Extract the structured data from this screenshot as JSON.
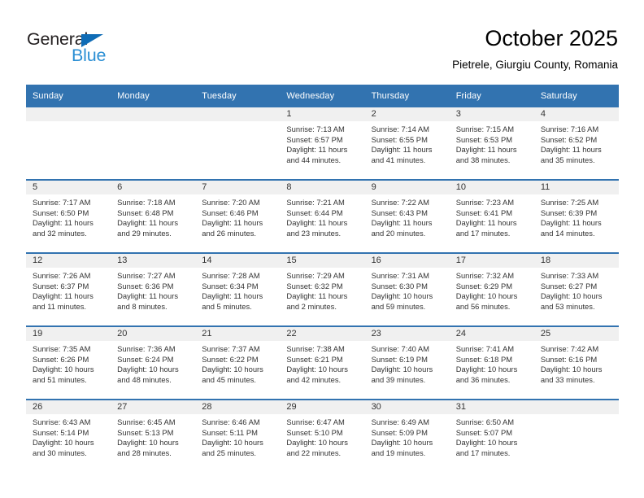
{
  "brand": {
    "name_part1": "General",
    "name_part2": "Blue",
    "primary_color": "#2b8fd4",
    "dark_color": "#231f20",
    "triangle_color": "#0f6cb6"
  },
  "header": {
    "title": "October 2025",
    "subtitle": "Pietrele, Giurgiu County, Romania"
  },
  "theme": {
    "header_row_bg": "#3273b0",
    "header_row_text": "#ffffff",
    "daynum_strip_bg": "#f0f0f0",
    "week_separator": "#3273b0",
    "body_text": "#333333"
  },
  "weekday_headers": [
    "Sunday",
    "Monday",
    "Tuesday",
    "Wednesday",
    "Thursday",
    "Friday",
    "Saturday"
  ],
  "weeks": [
    [
      {
        "day": "",
        "sunrise": "",
        "sunset": "",
        "daylight_line1": "",
        "daylight_line2": ""
      },
      {
        "day": "",
        "sunrise": "",
        "sunset": "",
        "daylight_line1": "",
        "daylight_line2": ""
      },
      {
        "day": "",
        "sunrise": "",
        "sunset": "",
        "daylight_line1": "",
        "daylight_line2": ""
      },
      {
        "day": "1",
        "sunrise": "Sunrise: 7:13 AM",
        "sunset": "Sunset: 6:57 PM",
        "daylight_line1": "Daylight: 11 hours",
        "daylight_line2": "and 44 minutes."
      },
      {
        "day": "2",
        "sunrise": "Sunrise: 7:14 AM",
        "sunset": "Sunset: 6:55 PM",
        "daylight_line1": "Daylight: 11 hours",
        "daylight_line2": "and 41 minutes."
      },
      {
        "day": "3",
        "sunrise": "Sunrise: 7:15 AM",
        "sunset": "Sunset: 6:53 PM",
        "daylight_line1": "Daylight: 11 hours",
        "daylight_line2": "and 38 minutes."
      },
      {
        "day": "4",
        "sunrise": "Sunrise: 7:16 AM",
        "sunset": "Sunset: 6:52 PM",
        "daylight_line1": "Daylight: 11 hours",
        "daylight_line2": "and 35 minutes."
      }
    ],
    [
      {
        "day": "5",
        "sunrise": "Sunrise: 7:17 AM",
        "sunset": "Sunset: 6:50 PM",
        "daylight_line1": "Daylight: 11 hours",
        "daylight_line2": "and 32 minutes."
      },
      {
        "day": "6",
        "sunrise": "Sunrise: 7:18 AM",
        "sunset": "Sunset: 6:48 PM",
        "daylight_line1": "Daylight: 11 hours",
        "daylight_line2": "and 29 minutes."
      },
      {
        "day": "7",
        "sunrise": "Sunrise: 7:20 AM",
        "sunset": "Sunset: 6:46 PM",
        "daylight_line1": "Daylight: 11 hours",
        "daylight_line2": "and 26 minutes."
      },
      {
        "day": "8",
        "sunrise": "Sunrise: 7:21 AM",
        "sunset": "Sunset: 6:44 PM",
        "daylight_line1": "Daylight: 11 hours",
        "daylight_line2": "and 23 minutes."
      },
      {
        "day": "9",
        "sunrise": "Sunrise: 7:22 AM",
        "sunset": "Sunset: 6:43 PM",
        "daylight_line1": "Daylight: 11 hours",
        "daylight_line2": "and 20 minutes."
      },
      {
        "day": "10",
        "sunrise": "Sunrise: 7:23 AM",
        "sunset": "Sunset: 6:41 PM",
        "daylight_line1": "Daylight: 11 hours",
        "daylight_line2": "and 17 minutes."
      },
      {
        "day": "11",
        "sunrise": "Sunrise: 7:25 AM",
        "sunset": "Sunset: 6:39 PM",
        "daylight_line1": "Daylight: 11 hours",
        "daylight_line2": "and 14 minutes."
      }
    ],
    [
      {
        "day": "12",
        "sunrise": "Sunrise: 7:26 AM",
        "sunset": "Sunset: 6:37 PM",
        "daylight_line1": "Daylight: 11 hours",
        "daylight_line2": "and 11 minutes."
      },
      {
        "day": "13",
        "sunrise": "Sunrise: 7:27 AM",
        "sunset": "Sunset: 6:36 PM",
        "daylight_line1": "Daylight: 11 hours",
        "daylight_line2": "and 8 minutes."
      },
      {
        "day": "14",
        "sunrise": "Sunrise: 7:28 AM",
        "sunset": "Sunset: 6:34 PM",
        "daylight_line1": "Daylight: 11 hours",
        "daylight_line2": "and 5 minutes."
      },
      {
        "day": "15",
        "sunrise": "Sunrise: 7:29 AM",
        "sunset": "Sunset: 6:32 PM",
        "daylight_line1": "Daylight: 11 hours",
        "daylight_line2": "and 2 minutes."
      },
      {
        "day": "16",
        "sunrise": "Sunrise: 7:31 AM",
        "sunset": "Sunset: 6:30 PM",
        "daylight_line1": "Daylight: 10 hours",
        "daylight_line2": "and 59 minutes."
      },
      {
        "day": "17",
        "sunrise": "Sunrise: 7:32 AM",
        "sunset": "Sunset: 6:29 PM",
        "daylight_line1": "Daylight: 10 hours",
        "daylight_line2": "and 56 minutes."
      },
      {
        "day": "18",
        "sunrise": "Sunrise: 7:33 AM",
        "sunset": "Sunset: 6:27 PM",
        "daylight_line1": "Daylight: 10 hours",
        "daylight_line2": "and 53 minutes."
      }
    ],
    [
      {
        "day": "19",
        "sunrise": "Sunrise: 7:35 AM",
        "sunset": "Sunset: 6:26 PM",
        "daylight_line1": "Daylight: 10 hours",
        "daylight_line2": "and 51 minutes."
      },
      {
        "day": "20",
        "sunrise": "Sunrise: 7:36 AM",
        "sunset": "Sunset: 6:24 PM",
        "daylight_line1": "Daylight: 10 hours",
        "daylight_line2": "and 48 minutes."
      },
      {
        "day": "21",
        "sunrise": "Sunrise: 7:37 AM",
        "sunset": "Sunset: 6:22 PM",
        "daylight_line1": "Daylight: 10 hours",
        "daylight_line2": "and 45 minutes."
      },
      {
        "day": "22",
        "sunrise": "Sunrise: 7:38 AM",
        "sunset": "Sunset: 6:21 PM",
        "daylight_line1": "Daylight: 10 hours",
        "daylight_line2": "and 42 minutes."
      },
      {
        "day": "23",
        "sunrise": "Sunrise: 7:40 AM",
        "sunset": "Sunset: 6:19 PM",
        "daylight_line1": "Daylight: 10 hours",
        "daylight_line2": "and 39 minutes."
      },
      {
        "day": "24",
        "sunrise": "Sunrise: 7:41 AM",
        "sunset": "Sunset: 6:18 PM",
        "daylight_line1": "Daylight: 10 hours",
        "daylight_line2": "and 36 minutes."
      },
      {
        "day": "25",
        "sunrise": "Sunrise: 7:42 AM",
        "sunset": "Sunset: 6:16 PM",
        "daylight_line1": "Daylight: 10 hours",
        "daylight_line2": "and 33 minutes."
      }
    ],
    [
      {
        "day": "26",
        "sunrise": "Sunrise: 6:43 AM",
        "sunset": "Sunset: 5:14 PM",
        "daylight_line1": "Daylight: 10 hours",
        "daylight_line2": "and 30 minutes."
      },
      {
        "day": "27",
        "sunrise": "Sunrise: 6:45 AM",
        "sunset": "Sunset: 5:13 PM",
        "daylight_line1": "Daylight: 10 hours",
        "daylight_line2": "and 28 minutes."
      },
      {
        "day": "28",
        "sunrise": "Sunrise: 6:46 AM",
        "sunset": "Sunset: 5:11 PM",
        "daylight_line1": "Daylight: 10 hours",
        "daylight_line2": "and 25 minutes."
      },
      {
        "day": "29",
        "sunrise": "Sunrise: 6:47 AM",
        "sunset": "Sunset: 5:10 PM",
        "daylight_line1": "Daylight: 10 hours",
        "daylight_line2": "and 22 minutes."
      },
      {
        "day": "30",
        "sunrise": "Sunrise: 6:49 AM",
        "sunset": "Sunset: 5:09 PM",
        "daylight_line1": "Daylight: 10 hours",
        "daylight_line2": "and 19 minutes."
      },
      {
        "day": "31",
        "sunrise": "Sunrise: 6:50 AM",
        "sunset": "Sunset: 5:07 PM",
        "daylight_line1": "Daylight: 10 hours",
        "daylight_line2": "and 17 minutes."
      },
      {
        "day": "",
        "sunrise": "",
        "sunset": "",
        "daylight_line1": "",
        "daylight_line2": ""
      }
    ]
  ]
}
